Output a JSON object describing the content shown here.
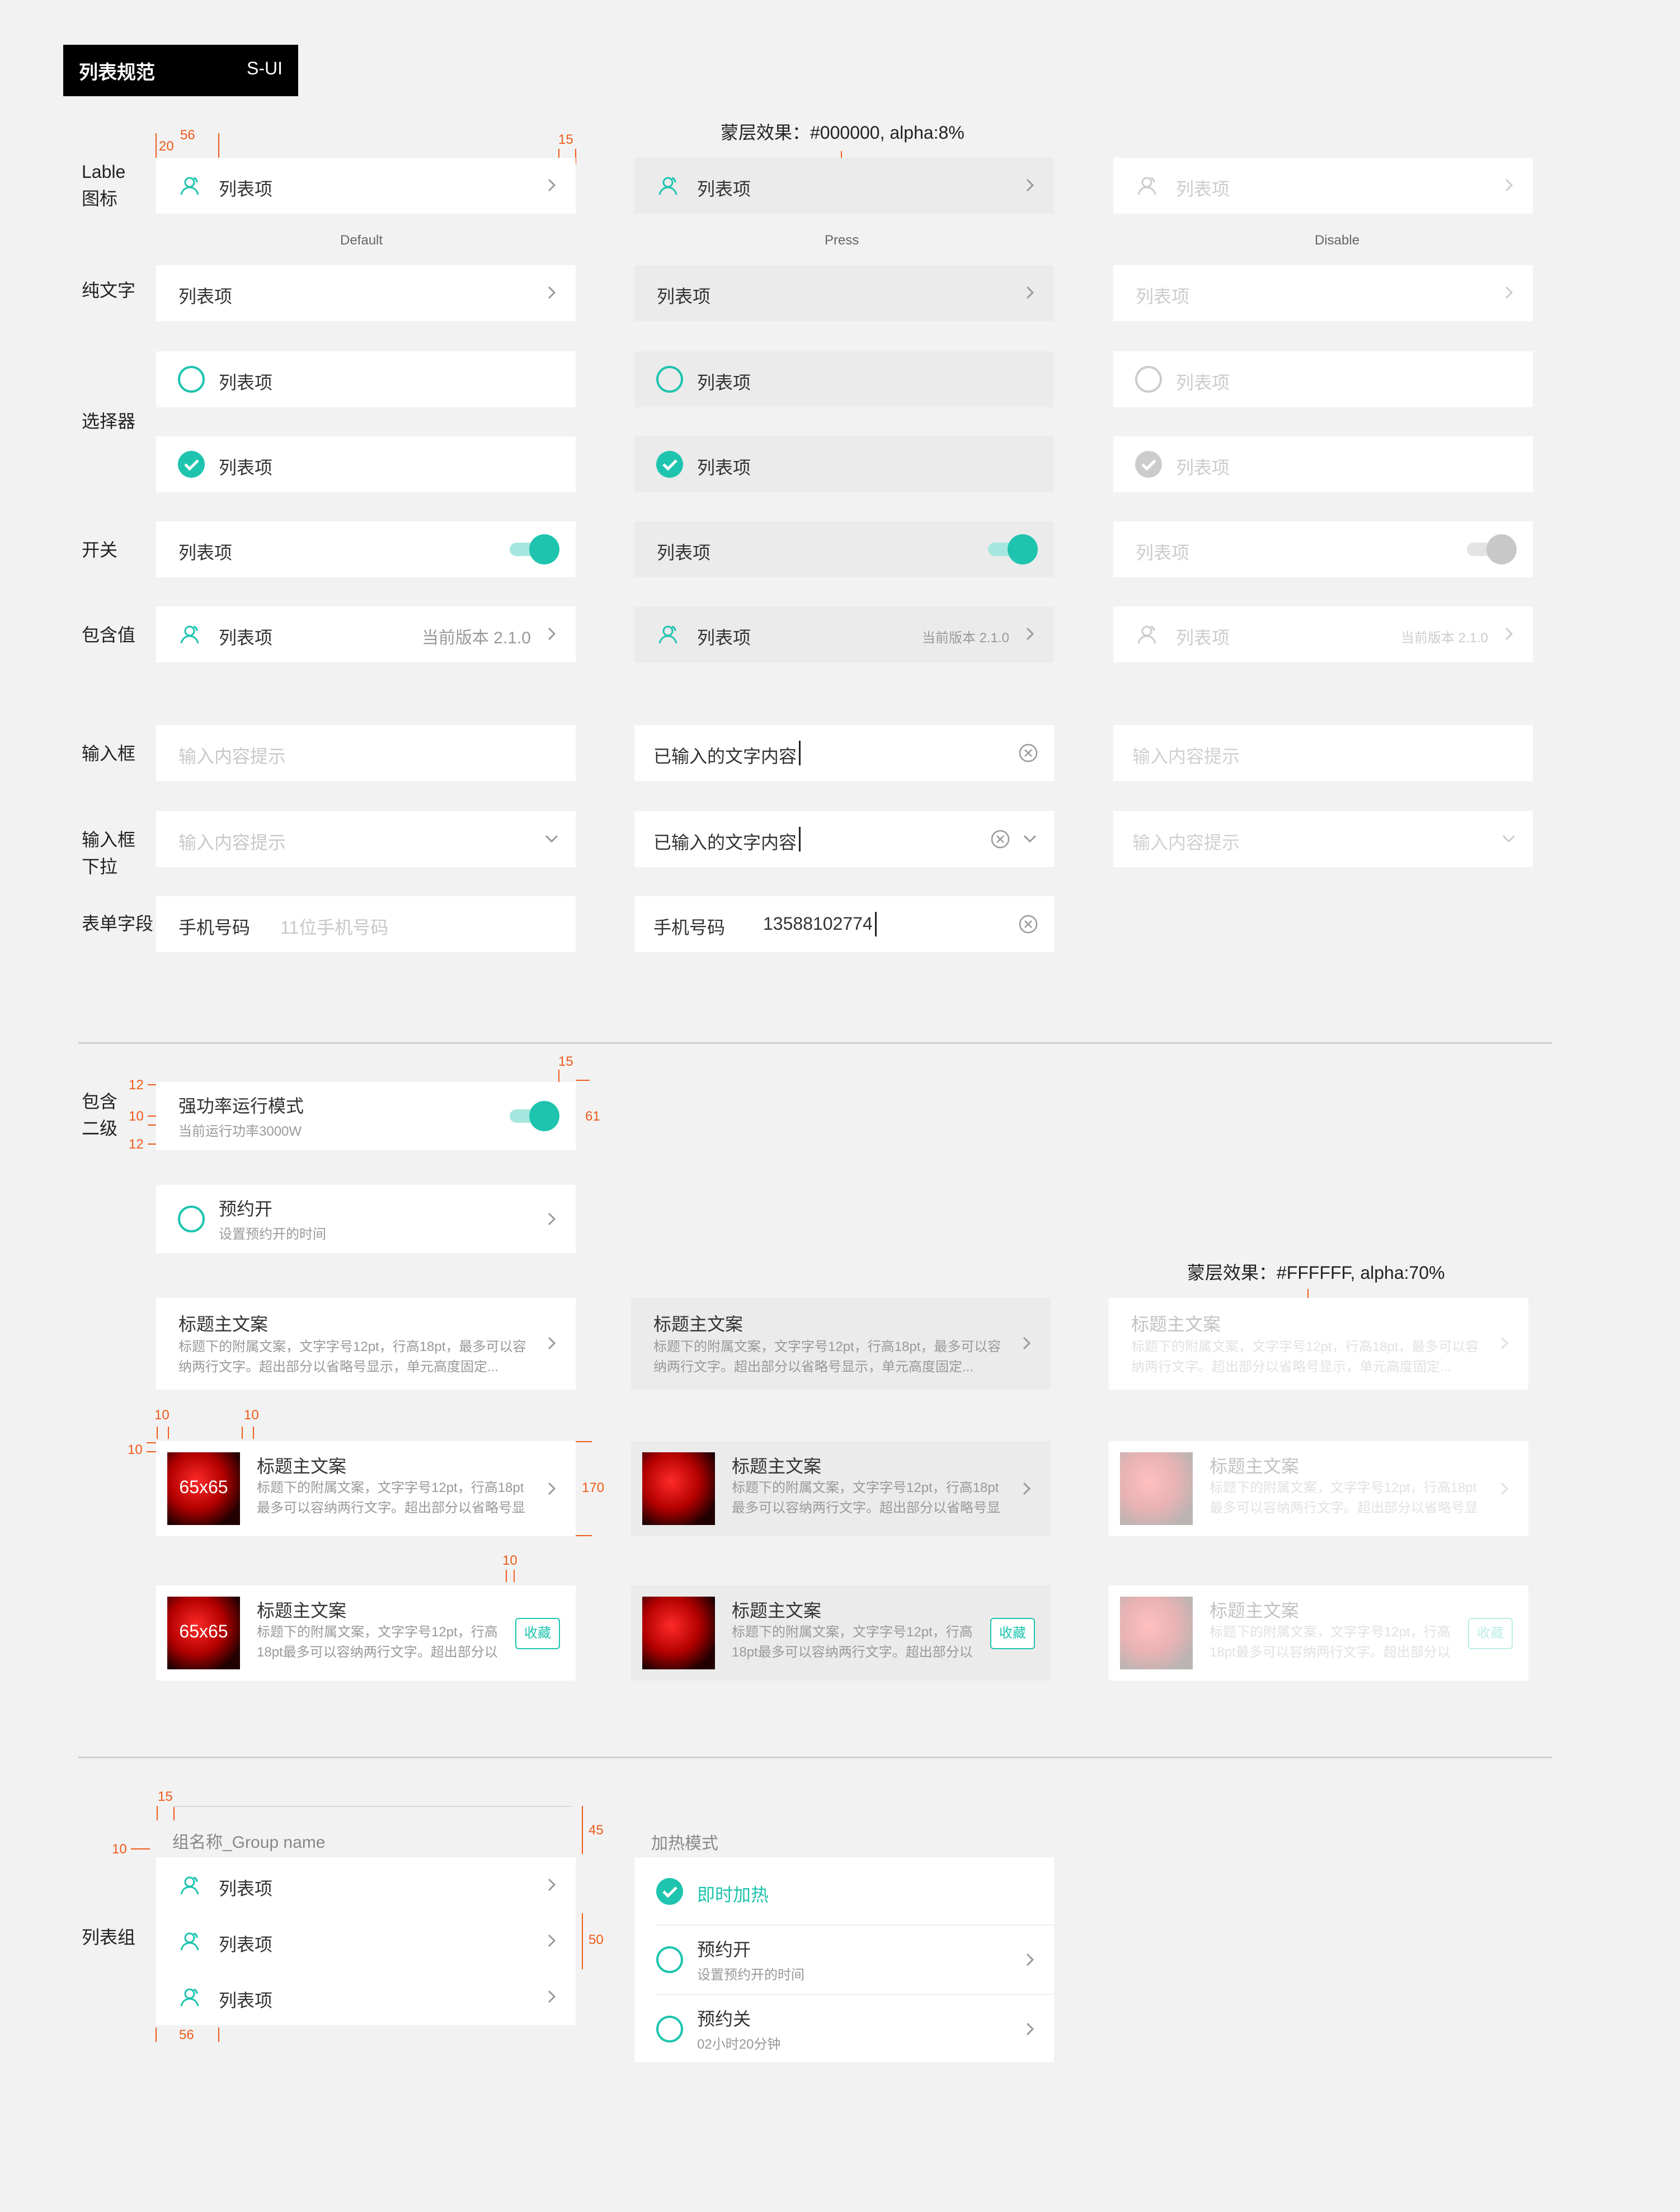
{
  "header": {
    "title": "列表规范",
    "brand": "S-UI"
  },
  "colors": {
    "accent": "#1ec4ae",
    "annotation": "#f05a19",
    "press_bg": "#ebebeb"
  },
  "notes": {
    "press_overlay": "蒙层效果：#000000, alpha:8%",
    "disable_overlay": "蒙层效果：#FFFFFF, alpha:70%"
  },
  "states": {
    "default": "Default",
    "press": "Press",
    "disable": "Disable"
  },
  "row_labels": {
    "label_icon_1": "Lable",
    "label_icon_2": "图标",
    "plain_text": "纯文字",
    "selector": "选择器",
    "switch": "开关",
    "with_value": "包含值",
    "input": "输入框",
    "input_dropdown_1": "输入框",
    "input_dropdown_2": "下拉",
    "form_field": "表单字段",
    "two_level_1": "包含",
    "two_level_2": "二级",
    "list_group": "列表组"
  },
  "list": {
    "item_label": "列表项",
    "value_text": "当前版本 2.1.0"
  },
  "input": {
    "placeholder": "输入内容提示",
    "entered": "已输入的文字内容"
  },
  "form": {
    "label": "手机号码",
    "placeholder": "11位手机号码",
    "value": "13588102774"
  },
  "two_level": {
    "power_title": "强功率运行模式",
    "power_sub": "当前运行功率3000W",
    "schedule_title": "预约开",
    "schedule_sub": "设置预约开的时间"
  },
  "cards": {
    "title": "标题主文案",
    "desc_line1": "标题下的附属文案，文字字号12pt，行高18pt，最多可以容",
    "desc_line2": "纳两行文字。超出部分以省略号显示，单元高度固定...",
    "img_desc_line1": "标题下的附属文案，文字字号12pt，行高18pt",
    "img_desc_line2": "最多可以容纳两行文字。超出部分以省略号显",
    "btn_desc_line1": "标题下的附属文案，文字字号12pt，行高",
    "btn_desc_line2": "18pt最多可以容纳两行文字。超出部分以",
    "thumb_label": "65x65",
    "fav_button": "收藏"
  },
  "group": {
    "name": "组名称_Group name",
    "heat_title": "加热模式",
    "heat_now": "即时加热",
    "schedule_on": "预约开",
    "schedule_on_sub": "设置预约开的时间",
    "schedule_off": "预约关",
    "schedule_off_sub": "02小时20分钟"
  },
  "annotations": {
    "a20": "20",
    "a56": "56",
    "a15": "15",
    "a12": "12",
    "a10": "10",
    "a61": "61",
    "a170": "170",
    "a45": "45",
    "a50": "50"
  }
}
